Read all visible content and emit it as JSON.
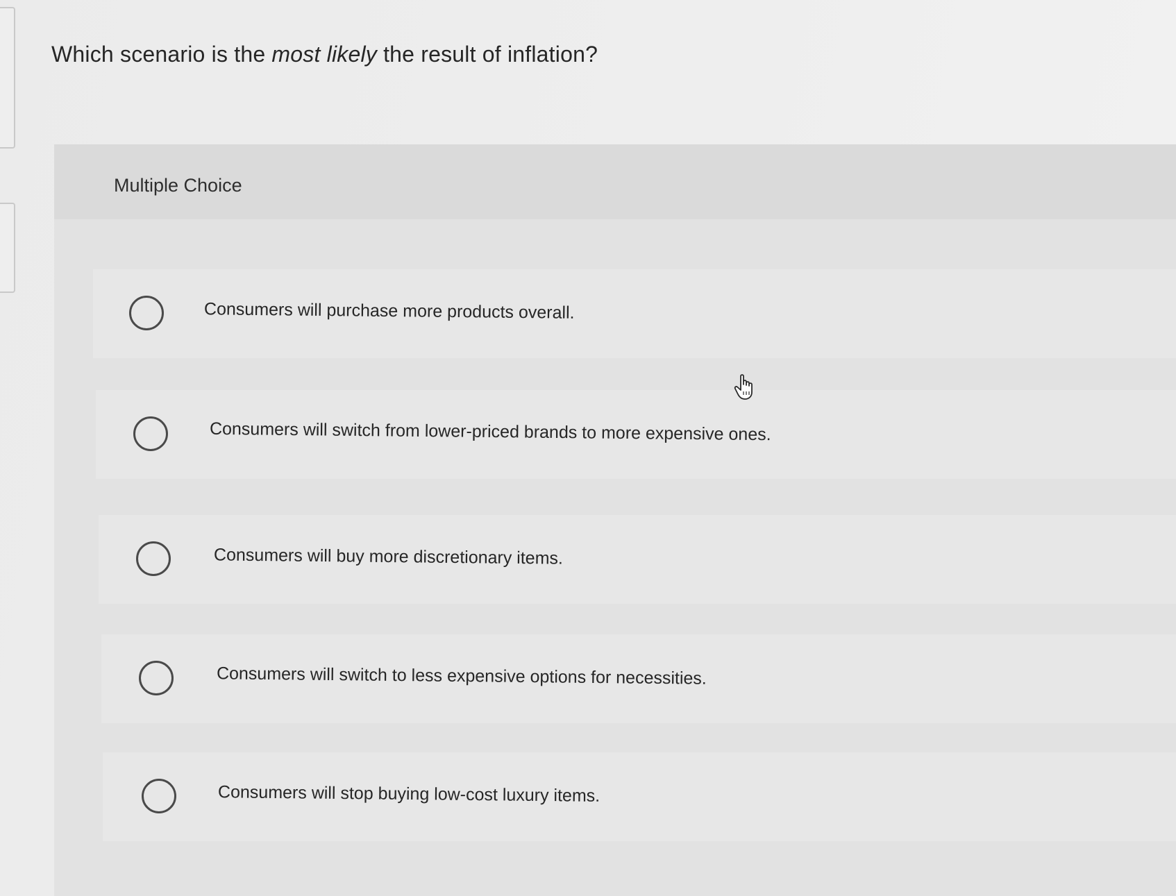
{
  "question": {
    "before": "Which scenario is the ",
    "emphasis": "most likely",
    "after": " the result of inflation?"
  },
  "section_label": "Multiple Choice",
  "choices": [
    {
      "label": "Consumers will purchase more products overall."
    },
    {
      "label": "Consumers will switch from lower-priced brands to more expensive ones."
    },
    {
      "label": "Consumers will buy more discretionary items."
    },
    {
      "label": "Consumers will switch to less expensive options for necessities."
    },
    {
      "label": "Consumers will stop buying low-cost luxury items."
    }
  ],
  "colors": {
    "background": "#ececec",
    "panel": "#e2e2e2",
    "text": "#262626",
    "radio_border": "#4a4a4a"
  },
  "icons": {
    "cursor": "hand-pointer-icon"
  }
}
